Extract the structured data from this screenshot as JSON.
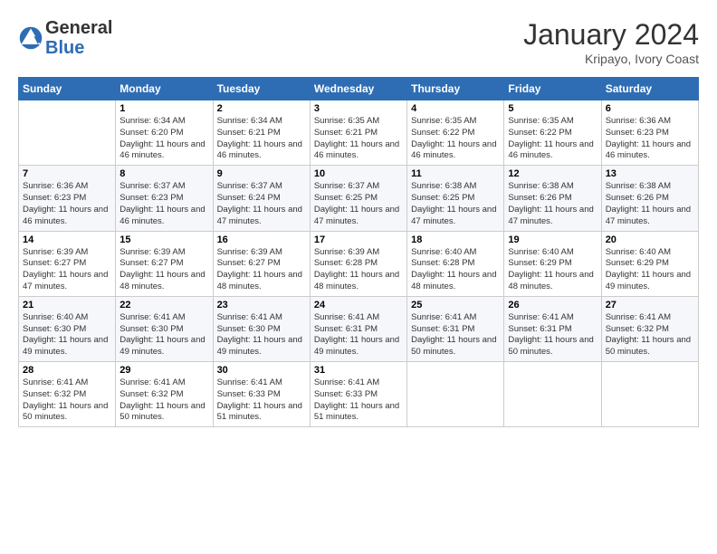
{
  "header": {
    "logo_general": "General",
    "logo_blue": "Blue",
    "month_year": "January 2024",
    "location": "Kripayo, Ivory Coast"
  },
  "weekdays": [
    "Sunday",
    "Monday",
    "Tuesday",
    "Wednesday",
    "Thursday",
    "Friday",
    "Saturday"
  ],
  "weeks": [
    [
      {
        "day": "",
        "sunrise": "",
        "sunset": "",
        "daylight": ""
      },
      {
        "day": "1",
        "sunrise": "Sunrise: 6:34 AM",
        "sunset": "Sunset: 6:20 PM",
        "daylight": "Daylight: 11 hours and 46 minutes."
      },
      {
        "day": "2",
        "sunrise": "Sunrise: 6:34 AM",
        "sunset": "Sunset: 6:21 PM",
        "daylight": "Daylight: 11 hours and 46 minutes."
      },
      {
        "day": "3",
        "sunrise": "Sunrise: 6:35 AM",
        "sunset": "Sunset: 6:21 PM",
        "daylight": "Daylight: 11 hours and 46 minutes."
      },
      {
        "day": "4",
        "sunrise": "Sunrise: 6:35 AM",
        "sunset": "Sunset: 6:22 PM",
        "daylight": "Daylight: 11 hours and 46 minutes."
      },
      {
        "day": "5",
        "sunrise": "Sunrise: 6:35 AM",
        "sunset": "Sunset: 6:22 PM",
        "daylight": "Daylight: 11 hours and 46 minutes."
      },
      {
        "day": "6",
        "sunrise": "Sunrise: 6:36 AM",
        "sunset": "Sunset: 6:23 PM",
        "daylight": "Daylight: 11 hours and 46 minutes."
      }
    ],
    [
      {
        "day": "7",
        "sunrise": "Sunrise: 6:36 AM",
        "sunset": "Sunset: 6:23 PM",
        "daylight": "Daylight: 11 hours and 46 minutes."
      },
      {
        "day": "8",
        "sunrise": "Sunrise: 6:37 AM",
        "sunset": "Sunset: 6:23 PM",
        "daylight": "Daylight: 11 hours and 46 minutes."
      },
      {
        "day": "9",
        "sunrise": "Sunrise: 6:37 AM",
        "sunset": "Sunset: 6:24 PM",
        "daylight": "Daylight: 11 hours and 47 minutes."
      },
      {
        "day": "10",
        "sunrise": "Sunrise: 6:37 AM",
        "sunset": "Sunset: 6:25 PM",
        "daylight": "Daylight: 11 hours and 47 minutes."
      },
      {
        "day": "11",
        "sunrise": "Sunrise: 6:38 AM",
        "sunset": "Sunset: 6:25 PM",
        "daylight": "Daylight: 11 hours and 47 minutes."
      },
      {
        "day": "12",
        "sunrise": "Sunrise: 6:38 AM",
        "sunset": "Sunset: 6:26 PM",
        "daylight": "Daylight: 11 hours and 47 minutes."
      },
      {
        "day": "13",
        "sunrise": "Sunrise: 6:38 AM",
        "sunset": "Sunset: 6:26 PM",
        "daylight": "Daylight: 11 hours and 47 minutes."
      }
    ],
    [
      {
        "day": "14",
        "sunrise": "Sunrise: 6:39 AM",
        "sunset": "Sunset: 6:27 PM",
        "daylight": "Daylight: 11 hours and 47 minutes."
      },
      {
        "day": "15",
        "sunrise": "Sunrise: 6:39 AM",
        "sunset": "Sunset: 6:27 PM",
        "daylight": "Daylight: 11 hours and 48 minutes."
      },
      {
        "day": "16",
        "sunrise": "Sunrise: 6:39 AM",
        "sunset": "Sunset: 6:27 PM",
        "daylight": "Daylight: 11 hours and 48 minutes."
      },
      {
        "day": "17",
        "sunrise": "Sunrise: 6:39 AM",
        "sunset": "Sunset: 6:28 PM",
        "daylight": "Daylight: 11 hours and 48 minutes."
      },
      {
        "day": "18",
        "sunrise": "Sunrise: 6:40 AM",
        "sunset": "Sunset: 6:28 PM",
        "daylight": "Daylight: 11 hours and 48 minutes."
      },
      {
        "day": "19",
        "sunrise": "Sunrise: 6:40 AM",
        "sunset": "Sunset: 6:29 PM",
        "daylight": "Daylight: 11 hours and 48 minutes."
      },
      {
        "day": "20",
        "sunrise": "Sunrise: 6:40 AM",
        "sunset": "Sunset: 6:29 PM",
        "daylight": "Daylight: 11 hours and 49 minutes."
      }
    ],
    [
      {
        "day": "21",
        "sunrise": "Sunrise: 6:40 AM",
        "sunset": "Sunset: 6:30 PM",
        "daylight": "Daylight: 11 hours and 49 minutes."
      },
      {
        "day": "22",
        "sunrise": "Sunrise: 6:41 AM",
        "sunset": "Sunset: 6:30 PM",
        "daylight": "Daylight: 11 hours and 49 minutes."
      },
      {
        "day": "23",
        "sunrise": "Sunrise: 6:41 AM",
        "sunset": "Sunset: 6:30 PM",
        "daylight": "Daylight: 11 hours and 49 minutes."
      },
      {
        "day": "24",
        "sunrise": "Sunrise: 6:41 AM",
        "sunset": "Sunset: 6:31 PM",
        "daylight": "Daylight: 11 hours and 49 minutes."
      },
      {
        "day": "25",
        "sunrise": "Sunrise: 6:41 AM",
        "sunset": "Sunset: 6:31 PM",
        "daylight": "Daylight: 11 hours and 50 minutes."
      },
      {
        "day": "26",
        "sunrise": "Sunrise: 6:41 AM",
        "sunset": "Sunset: 6:31 PM",
        "daylight": "Daylight: 11 hours and 50 minutes."
      },
      {
        "day": "27",
        "sunrise": "Sunrise: 6:41 AM",
        "sunset": "Sunset: 6:32 PM",
        "daylight": "Daylight: 11 hours and 50 minutes."
      }
    ],
    [
      {
        "day": "28",
        "sunrise": "Sunrise: 6:41 AM",
        "sunset": "Sunset: 6:32 PM",
        "daylight": "Daylight: 11 hours and 50 minutes."
      },
      {
        "day": "29",
        "sunrise": "Sunrise: 6:41 AM",
        "sunset": "Sunset: 6:32 PM",
        "daylight": "Daylight: 11 hours and 50 minutes."
      },
      {
        "day": "30",
        "sunrise": "Sunrise: 6:41 AM",
        "sunset": "Sunset: 6:33 PM",
        "daylight": "Daylight: 11 hours and 51 minutes."
      },
      {
        "day": "31",
        "sunrise": "Sunrise: 6:41 AM",
        "sunset": "Sunset: 6:33 PM",
        "daylight": "Daylight: 11 hours and 51 minutes."
      },
      {
        "day": "",
        "sunrise": "",
        "sunset": "",
        "daylight": ""
      },
      {
        "day": "",
        "sunrise": "",
        "sunset": "",
        "daylight": ""
      },
      {
        "day": "",
        "sunrise": "",
        "sunset": "",
        "daylight": ""
      }
    ]
  ]
}
